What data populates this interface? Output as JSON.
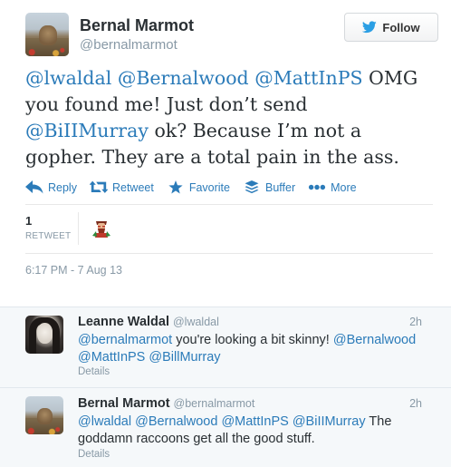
{
  "author": {
    "name": "Bernal Marmot",
    "handle": "@bernalmarmot"
  },
  "follow": {
    "label": "Follow"
  },
  "tweet": {
    "mentions": [
      "@lwaldal",
      "@Bernalwood",
      "@MattInPS",
      "@BiIIMurray"
    ],
    "text_parts": [
      " ",
      " ",
      " OMG you found me! Just don’t send ",
      " ok? Because I’m not a gopher. They are a total pain in the ass."
    ]
  },
  "actions": {
    "reply": "Reply",
    "retweet": "Retweet",
    "favorite": "Favorite",
    "buffer": "Buffer",
    "more": "More"
  },
  "stats": {
    "retweet_count": "1",
    "retweet_label": "RETWEET"
  },
  "timestamp": "6:17 PM - 7 Aug 13",
  "replies": [
    {
      "name": "Leanne Waldal",
      "handle": "@lwaldal",
      "time": "2h",
      "mention_1": "@bernalmarmot",
      "text_1": " you're looking a bit skinny! ",
      "mention_2": "@Bernalwood",
      "mention_3": "@MattInPS",
      "mention_4": "@BillMurray",
      "details": "Details"
    },
    {
      "name": "Bernal Marmot",
      "handle": "@bernalmarmot",
      "time": "2h",
      "mention_1": "@lwaldal",
      "mention_2": "@Bernalwood",
      "mention_3": "@MattInPS",
      "mention_4": "@BiIIMurray",
      "text_1": " The goddamn raccoons get all the good stuff.",
      "details": "Details"
    }
  ],
  "colors": {
    "link": "#2b7bb9",
    "muted": "#8899a6",
    "text": "#292f33",
    "reply_bg": "#f5f8fa"
  },
  "icons": [
    "twitter-bird-icon",
    "reply-icon",
    "retweet-icon",
    "favorite-star-icon",
    "buffer-icon",
    "more-dots-icon"
  ]
}
